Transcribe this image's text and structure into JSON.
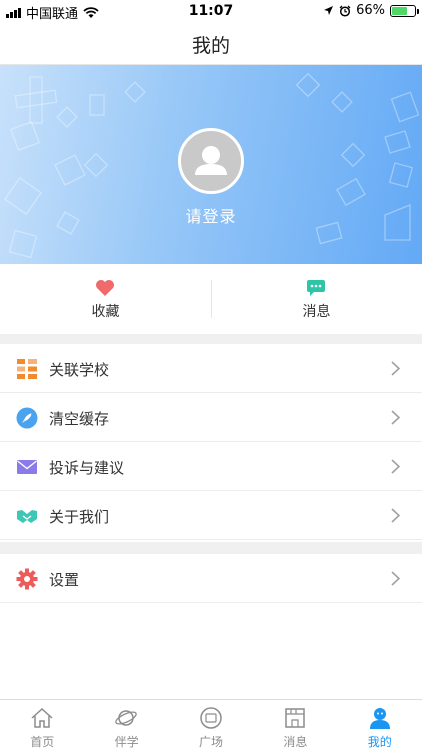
{
  "status_bar": {
    "carrier": "中国联通",
    "time": "11:07",
    "battery": "66%",
    "battery_level": 0.66
  },
  "nav": {
    "title": "我的"
  },
  "profile": {
    "login_label": "请登录",
    "avatar_icon": "user-avatar-icon"
  },
  "quick_actions": [
    {
      "label": "收藏",
      "icon": "heart-icon",
      "color": "#ef6b6b"
    },
    {
      "label": "消息",
      "icon": "chat-bubble-icon",
      "color": "#2ec4a5"
    }
  ],
  "menu": [
    {
      "label": "关联学校",
      "icon": "grid-icon",
      "color": "#f28a2e"
    },
    {
      "label": "清空缓存",
      "icon": "rocket-icon",
      "color": "#4aa3ef"
    },
    {
      "label": "投诉与建议",
      "icon": "envelope-icon",
      "color": "#8a7be8"
    },
    {
      "label": "关于我们",
      "icon": "handshake-icon",
      "color": "#3cc8b4"
    }
  ],
  "settings": {
    "label": "设置",
    "icon": "gear-icon",
    "color": "#ee5b5b"
  },
  "tabs": [
    {
      "label": "首页",
      "icon": "home-icon",
      "active": false
    },
    {
      "label": "伴学",
      "icon": "planet-icon",
      "active": false
    },
    {
      "label": "广场",
      "icon": "plaza-icon",
      "active": false
    },
    {
      "label": "消息",
      "icon": "message-icon",
      "active": false
    },
    {
      "label": "我的",
      "icon": "profile-icon",
      "active": true
    }
  ],
  "colors": {
    "accent": "#1a96f0",
    "banner_start": "#c8e1fb",
    "banner_end": "#63a9f6"
  }
}
